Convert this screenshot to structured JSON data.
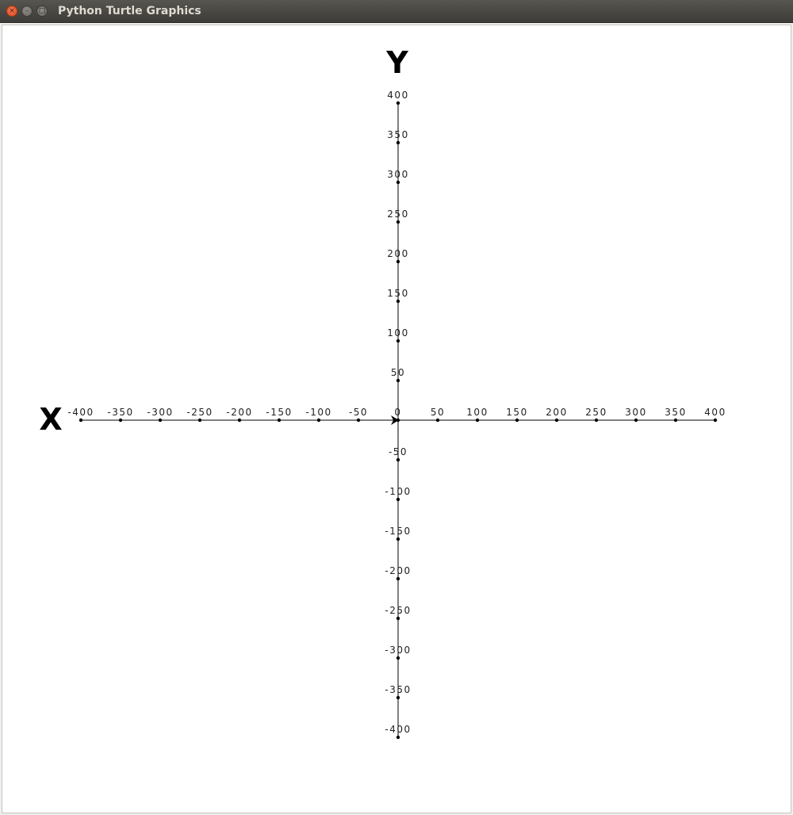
{
  "window": {
    "title": "Python Turtle Graphics",
    "close_glyph": "×",
    "minimize_glyph": "–",
    "maximize_glyph": "□"
  },
  "axes": {
    "x_name": "X",
    "y_name": "Y",
    "x_ticks": [
      "-400",
      "-350",
      "-300",
      "-250",
      "-200",
      "-150",
      "-100",
      "-50",
      "0",
      "50",
      "100",
      "150",
      "200",
      "250",
      "300",
      "350",
      "400"
    ],
    "y_ticks": [
      "400",
      "350",
      "300",
      "250",
      "200",
      "150",
      "100",
      "50",
      "-50",
      "-100",
      "-150",
      "-200",
      "-250",
      "-300",
      "-350",
      "-400"
    ]
  }
}
